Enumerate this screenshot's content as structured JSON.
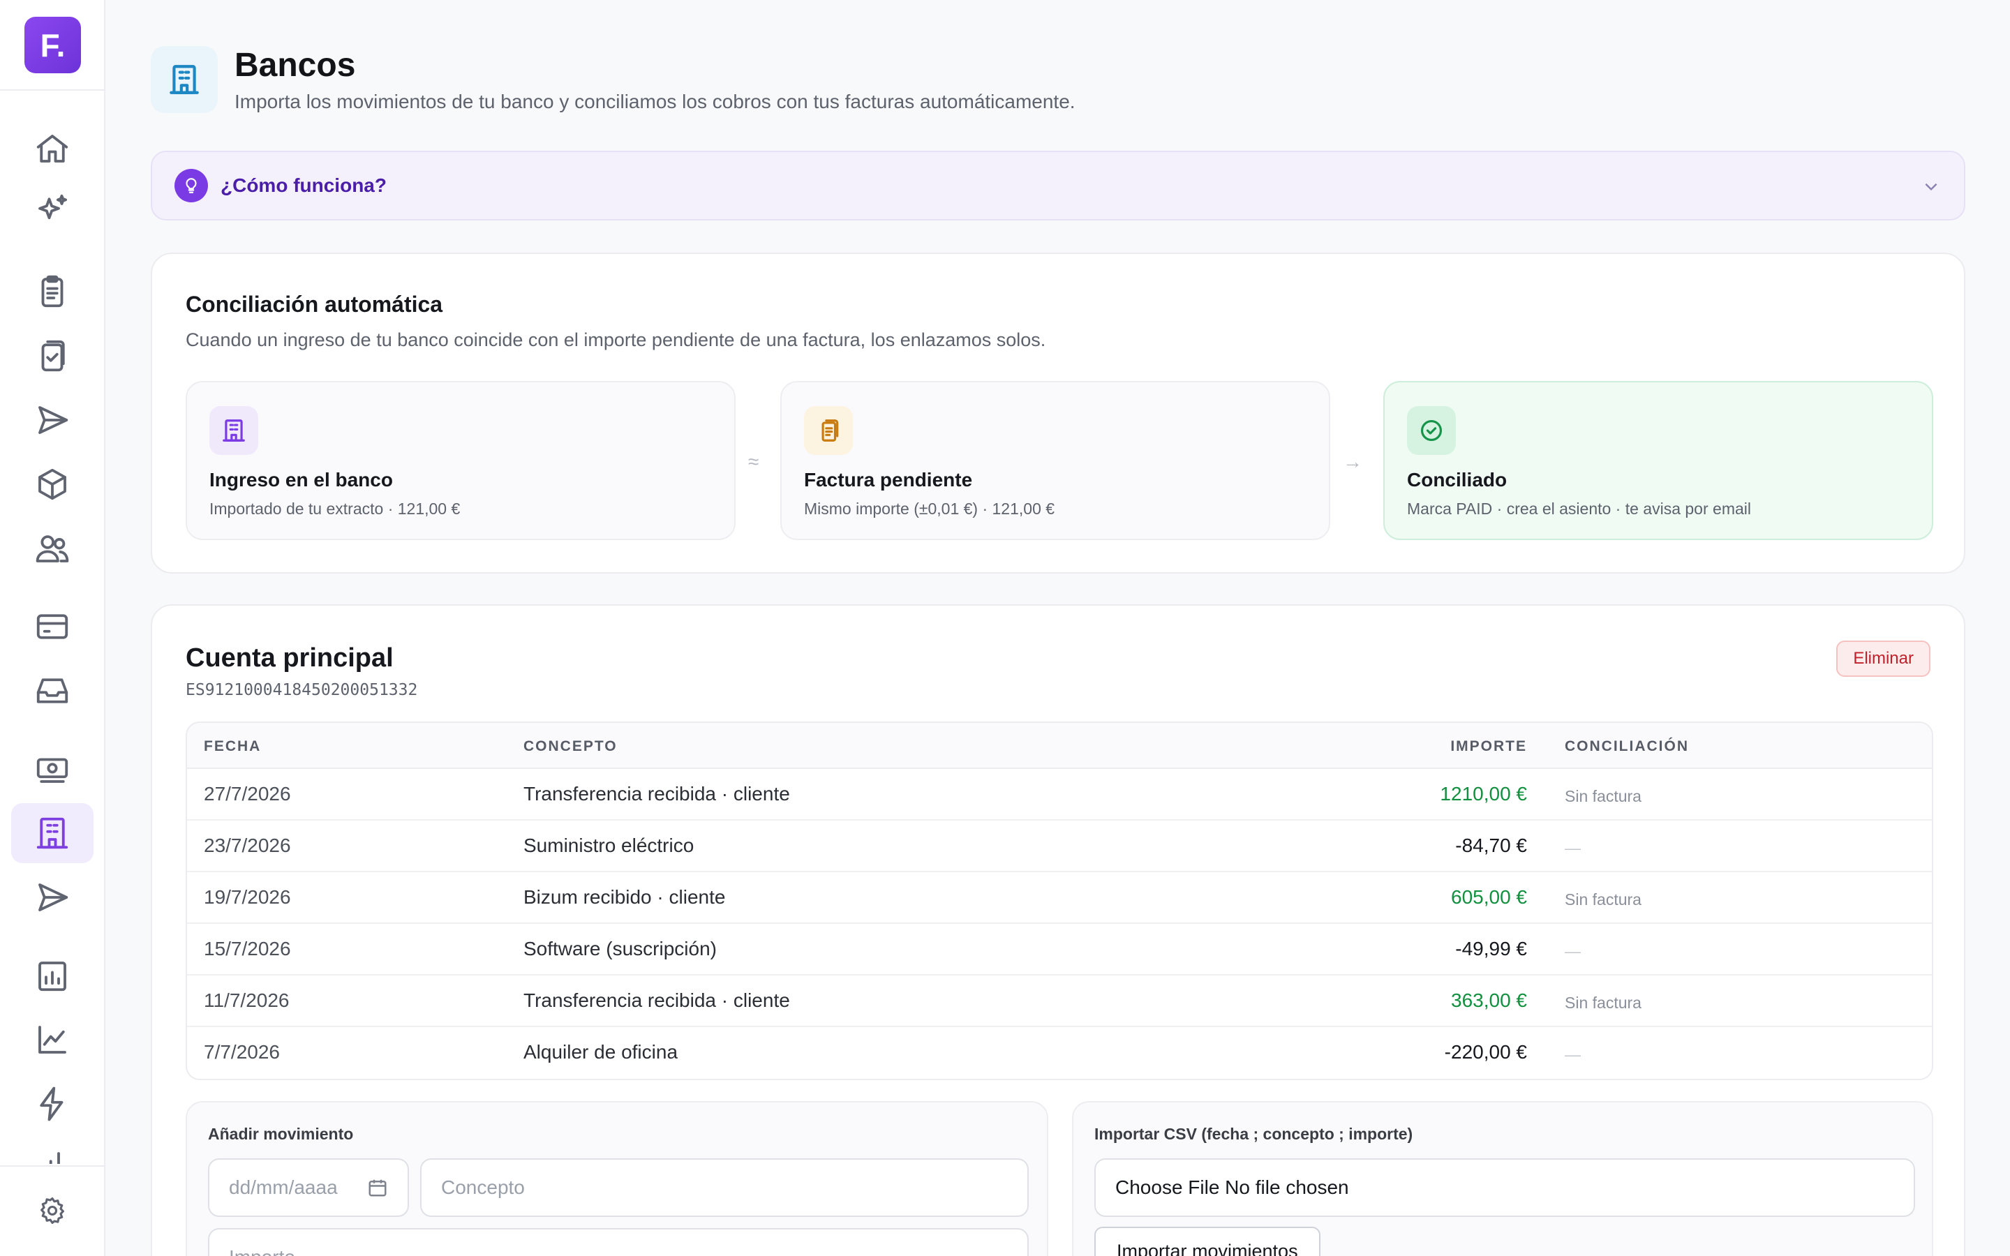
{
  "app": {
    "logo_text": "F."
  },
  "sidebar": {
    "items": [
      {
        "name": "home-icon",
        "active": false
      },
      {
        "name": "sparkles-icon",
        "active": false
      },
      {
        "name": "invoices-icon",
        "active": false
      },
      {
        "name": "approved-invoices-icon",
        "active": false
      },
      {
        "name": "send-icon",
        "active": false
      },
      {
        "name": "box-icon",
        "active": false
      },
      {
        "name": "users-icon",
        "active": false
      },
      {
        "name": "credit-card-icon",
        "active": false
      },
      {
        "name": "inbox-icon",
        "active": false
      },
      {
        "name": "cash-icon",
        "active": false
      },
      {
        "name": "bank-icon",
        "active": true
      },
      {
        "name": "send-icon",
        "active": false
      },
      {
        "name": "report-icon",
        "active": false
      },
      {
        "name": "chart-line-icon",
        "active": false
      },
      {
        "name": "lightning-icon",
        "active": false
      },
      {
        "name": "bar-chart-icon",
        "active": false
      },
      {
        "name": "gear-icon",
        "active": false
      }
    ]
  },
  "header": {
    "icon": "bank-icon",
    "title": "Bancos",
    "subtitle": "Importa los movimientos de tu banco y conciliamos los cobros con tus facturas automáticamente."
  },
  "howto": {
    "label": "¿Cómo funciona?"
  },
  "reconciliation": {
    "title": "Conciliación automática",
    "description": "Cuando un ingreso de tu banco coincide con el importe pendiente de una factura, los enlazamos solos.",
    "separator_1": "≈",
    "separator_2": "→",
    "steps": [
      {
        "icon": "bank-icon",
        "title": "Ingreso en el banco",
        "subtitle": "Importado de tu extracto · 121,00 €"
      },
      {
        "icon": "invoice-icon",
        "title": "Factura pendiente",
        "subtitle": "Mismo importe (±0,01 €) · 121,00 €"
      },
      {
        "icon": "check-circle-icon",
        "title": "Conciliado",
        "subtitle": "Marca PAID · crea el asiento · te avisa por email"
      }
    ]
  },
  "account": {
    "name": "Cuenta principal",
    "iban": "ES9121000418450200051332",
    "delete_label": "Eliminar",
    "columns": {
      "date": "FECHA",
      "concept": "CONCEPTO",
      "amount": "IMPORTE",
      "reconciliation": "CONCILIACIÓN"
    },
    "rows": [
      {
        "date": "27/7/2026",
        "concept": "Transferencia recibida · cliente",
        "amount": "1210,00 €",
        "status": "Sin factura",
        "positive": true
      },
      {
        "date": "23/7/2026",
        "concept": "Suministro eléctrico",
        "amount": "-84,70 €",
        "status": "—",
        "positive": false
      },
      {
        "date": "19/7/2026",
        "concept": "Bizum recibido · cliente",
        "amount": "605,00 €",
        "status": "Sin factura",
        "positive": true
      },
      {
        "date": "15/7/2026",
        "concept": "Software (suscripción)",
        "amount": "-49,99 €",
        "status": "—",
        "positive": false
      },
      {
        "date": "11/7/2026",
        "concept": "Transferencia recibida · cliente",
        "amount": "363,00 €",
        "status": "Sin factura",
        "positive": true
      },
      {
        "date": "7/7/2026",
        "concept": "Alquiler de oficina",
        "amount": "-220,00 €",
        "status": "—",
        "positive": false
      }
    ]
  },
  "add_movement": {
    "label": "Añadir movimiento",
    "date_placeholder": "dd/mm/aaaa",
    "concept_placeholder": "Concepto",
    "amount_placeholder": "Importe"
  },
  "import_csv": {
    "label": "Importar CSV (fecha ; concepto ; importe)",
    "file_input_text": "Choose File No file chosen",
    "button_label": "Importar movimientos"
  },
  "colors": {
    "accent": "#7b3be4",
    "positive": "#12903f",
    "danger": "#c0212b"
  }
}
